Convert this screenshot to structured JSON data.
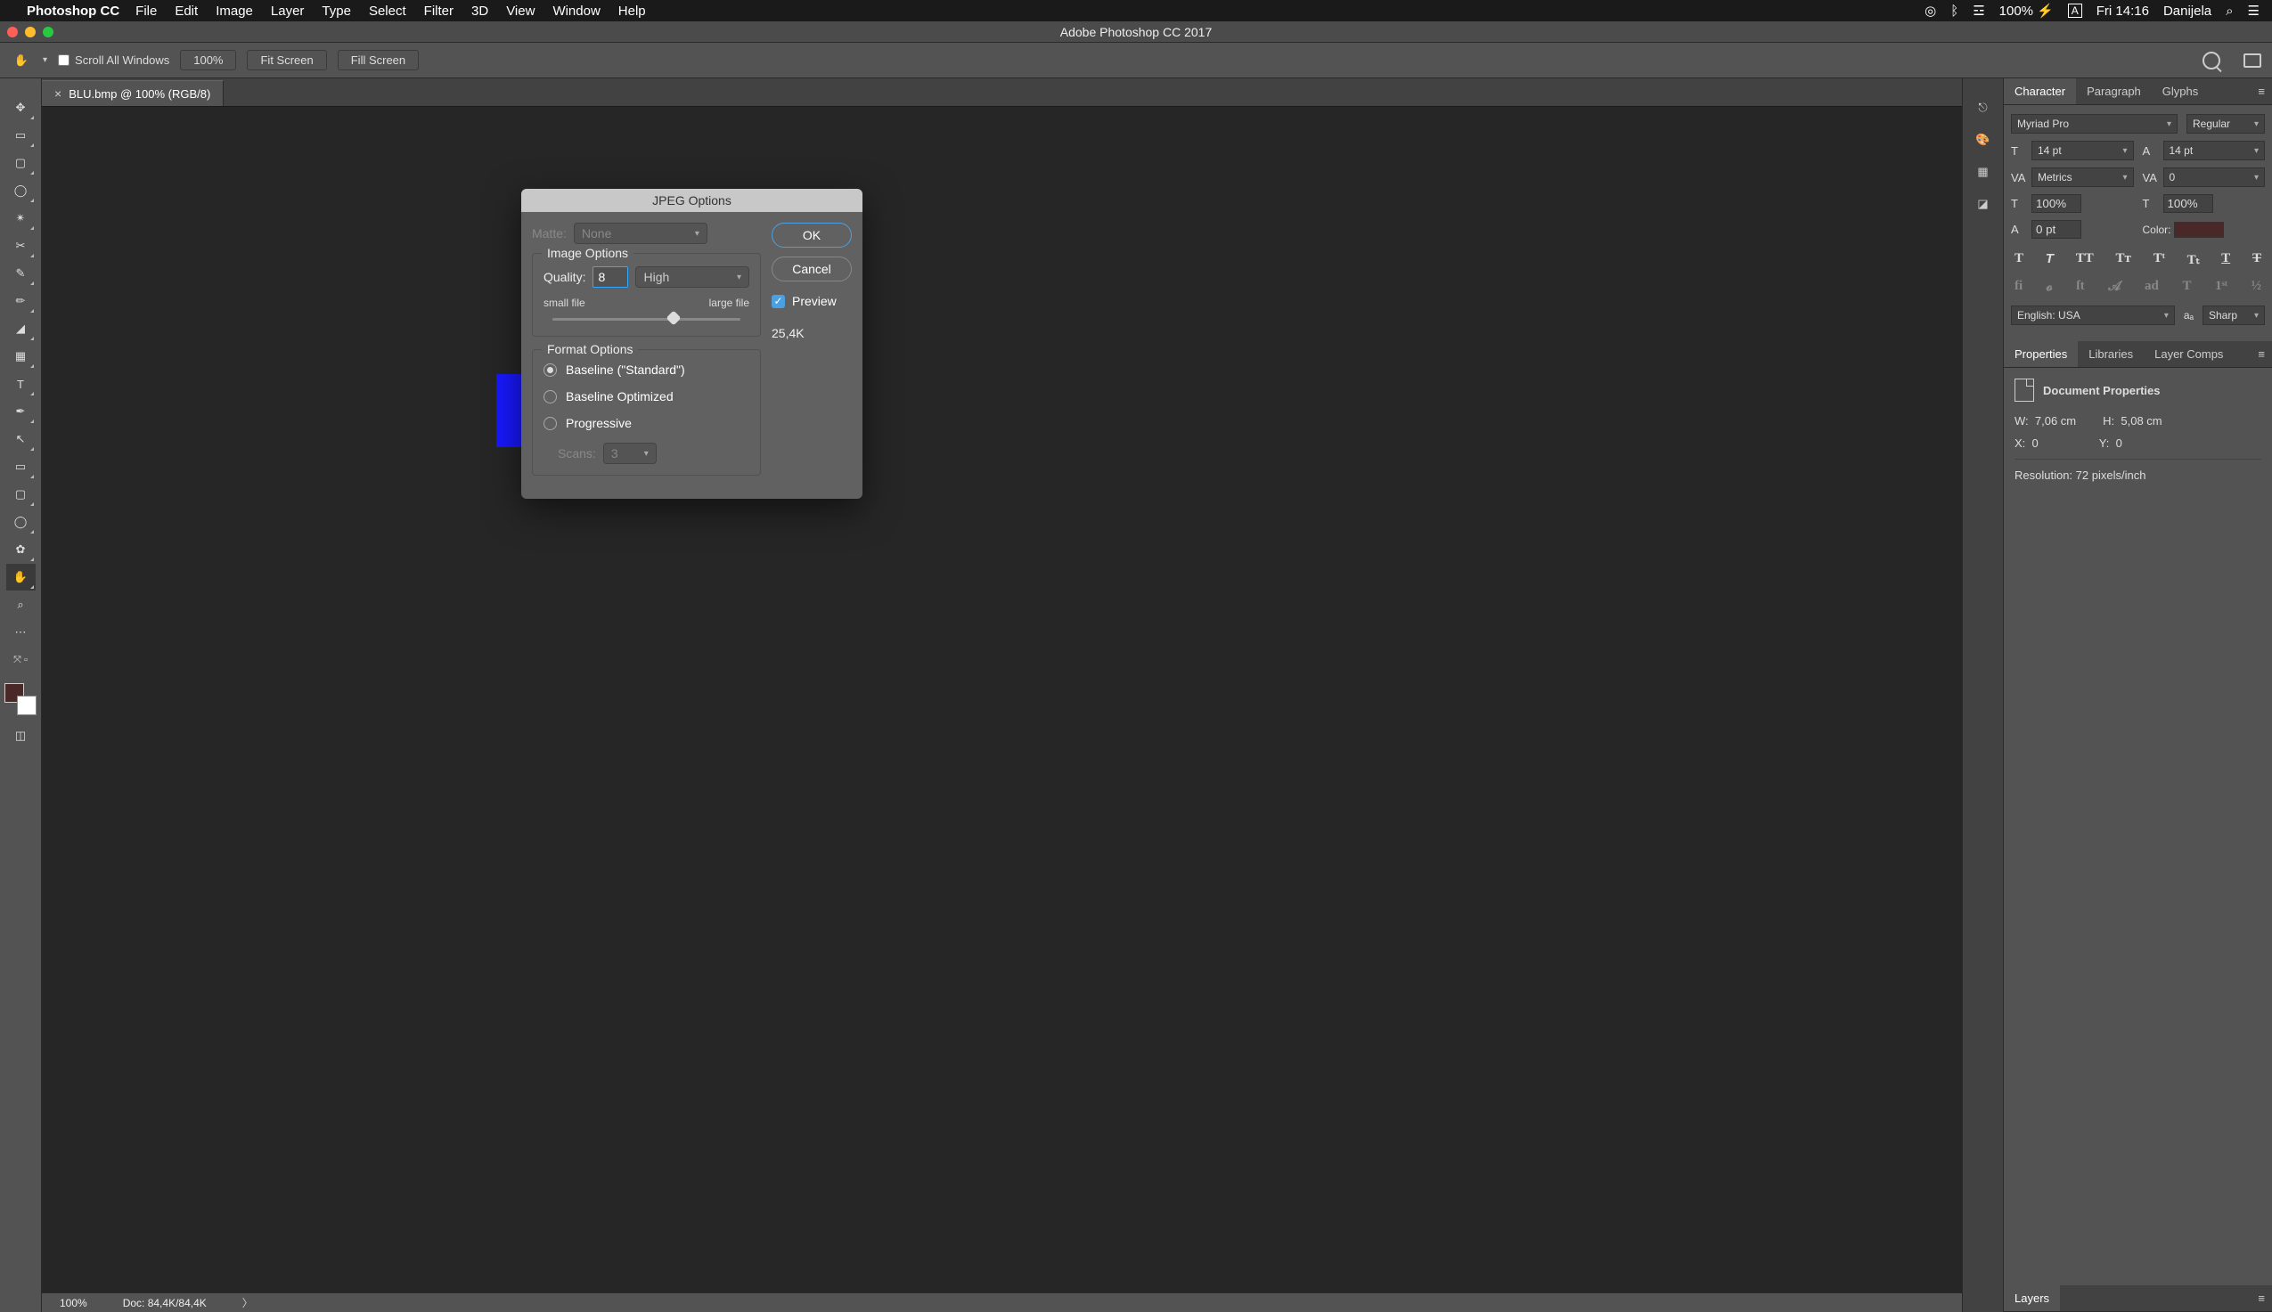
{
  "menubar": {
    "app": "Photoshop CC",
    "items": [
      "File",
      "Edit",
      "Image",
      "Layer",
      "Type",
      "Select",
      "Filter",
      "3D",
      "View",
      "Window",
      "Help"
    ],
    "battery": "100%",
    "clock": "Fri 14:16",
    "user": "Danijela"
  },
  "titlebar": {
    "title": "Adobe Photoshop CC 2017"
  },
  "options_bar": {
    "scroll_all_label": "Scroll All Windows",
    "btn_100": "100%",
    "btn_fit": "Fit Screen",
    "btn_fill": "Fill Screen"
  },
  "document": {
    "tab_label": "BLU.bmp @ 100% (RGB/8)"
  },
  "status": {
    "zoom": "100%",
    "doc": "Doc: 84,4K/84,4K"
  },
  "dialog": {
    "title": "JPEG Options",
    "matte_label": "Matte:",
    "matte_value": "None",
    "image_options_legend": "Image Options",
    "quality_label": "Quality:",
    "quality_value": "8",
    "quality_preset": "High",
    "small_file": "small file",
    "large_file": "large file",
    "slider_percent": 68,
    "format_options_legend": "Format Options",
    "radio_standard": "Baseline (\"Standard\")",
    "radio_optimized": "Baseline Optimized",
    "radio_progressive": "Progressive",
    "scans_label": "Scans:",
    "scans_value": "3",
    "ok": "OK",
    "cancel": "Cancel",
    "preview": "Preview",
    "filesize": "25,4K"
  },
  "character_panel": {
    "tabs": [
      "Character",
      "Paragraph",
      "Glyphs"
    ],
    "font": "Myriad Pro",
    "style": "Regular",
    "size": "14 pt",
    "leading": "14 pt",
    "kerning": "Metrics",
    "tracking": "0",
    "vscale": "100%",
    "hscale": "100%",
    "baseline": "0 pt",
    "color_label": "Color:",
    "language": "English: USA",
    "aa": "Sharp"
  },
  "properties_panel": {
    "tabs": [
      "Properties",
      "Libraries",
      "Layer Comps"
    ],
    "title": "Document Properties",
    "w_label": "W:",
    "w_value": "7,06 cm",
    "h_label": "H:",
    "h_value": "5,08 cm",
    "x_label": "X:",
    "x_value": "0",
    "y_label": "Y:",
    "y_value": "0",
    "resolution": "Resolution: 72 pixels/inch"
  },
  "layers_panel": {
    "tab": "Layers"
  }
}
